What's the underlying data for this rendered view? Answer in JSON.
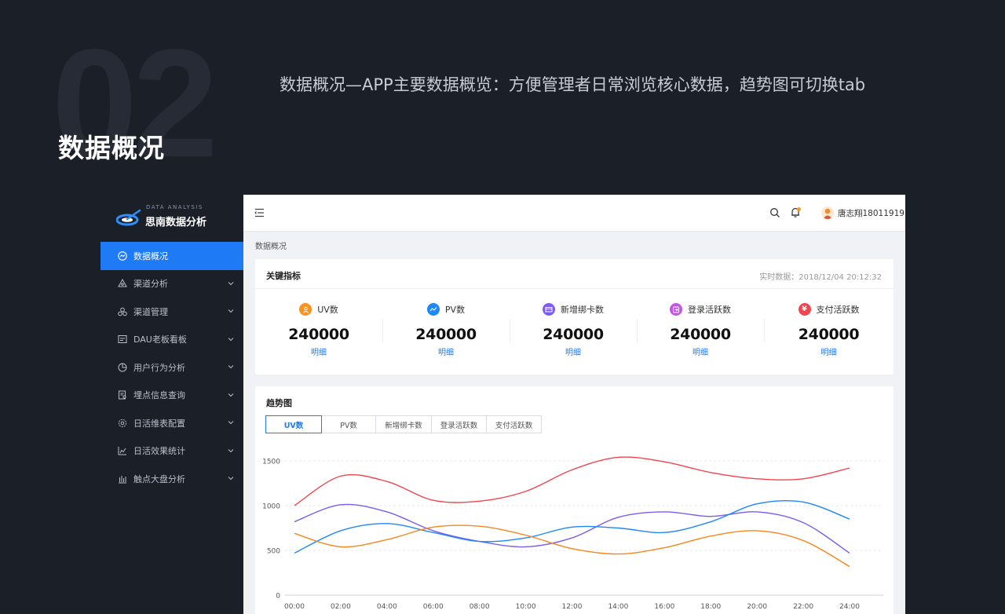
{
  "hero": {
    "number": "02",
    "title": "数据概况",
    "description": "数据概况—APP主要数据概览：方便管理者日常浏览核心数据，趋势图可切换tab"
  },
  "app": {
    "logo_sub": "DATA ANALYSIS",
    "logo_name": "思南数据分析"
  },
  "sidebar": {
    "items": [
      {
        "label": "数据概况",
        "icon": "trend-icon",
        "active": true
      },
      {
        "label": "渠道分析",
        "icon": "channel-icon"
      },
      {
        "label": "渠道管理",
        "icon": "manage-icon"
      },
      {
        "label": "DAU老板看板",
        "icon": "board-icon"
      },
      {
        "label": "用户行为分析",
        "icon": "pie-icon"
      },
      {
        "label": "埋点信息查询",
        "icon": "query-icon"
      },
      {
        "label": "日活维表配置",
        "icon": "gear-icon"
      },
      {
        "label": "日活效果统计",
        "icon": "bar-chart-icon"
      },
      {
        "label": "触点大盘分析",
        "icon": "columns-icon"
      }
    ]
  },
  "header": {
    "user": "唐志翔18011919"
  },
  "breadcrumb": "数据概况",
  "kpi": {
    "title": "关键指标",
    "realtime": "实时数据：2018/12/04 20:12:32",
    "detail_label": "明细",
    "items": [
      {
        "label": "UV数",
        "value": "240000",
        "color": "#f7931e"
      },
      {
        "label": "PV数",
        "value": "240000",
        "color": "#1e88f5"
      },
      {
        "label": "新增绑卡数",
        "value": "240000",
        "color": "#7c5cf0"
      },
      {
        "label": "登录活跃数",
        "value": "240000",
        "color": "#c653e8"
      },
      {
        "label": "支付活跃数",
        "value": "240000",
        "color": "#f0454f"
      }
    ]
  },
  "trend": {
    "title": "趋势图",
    "tabs": [
      "UV数",
      "PV数",
      "新增绑卡数",
      "登录活跃数",
      "支付活跃数"
    ],
    "active_tab": 0
  },
  "chart_data": {
    "type": "line",
    "x": [
      "00:00",
      "02:00",
      "04:00",
      "06:00",
      "08:00",
      "10:00",
      "12:00",
      "14:00",
      "16:00",
      "18:00",
      "20:00",
      "22:00",
      "24:00"
    ],
    "ylim": [
      0,
      1500
    ],
    "yticks": [
      0,
      500,
      1000,
      1500
    ],
    "grid": true,
    "series": [
      {
        "color": "#f0454f",
        "values": [
          1000,
          1330,
          1270,
          1060,
          1050,
          1160,
          1400,
          1540,
          1490,
          1370,
          1300,
          1300,
          1420
        ]
      },
      {
        "color": "#7c5cf0",
        "values": [
          820,
          1010,
          930,
          720,
          600,
          540,
          640,
          870,
          930,
          880,
          930,
          810,
          470
        ]
      },
      {
        "color": "#1e88f5",
        "values": [
          470,
          720,
          800,
          700,
          600,
          640,
          760,
          750,
          700,
          820,
          1020,
          1040,
          850
        ]
      },
      {
        "color": "#f7861e",
        "values": [
          690,
          540,
          620,
          760,
          770,
          670,
          520,
          460,
          530,
          660,
          720,
          610,
          320
        ]
      }
    ]
  }
}
